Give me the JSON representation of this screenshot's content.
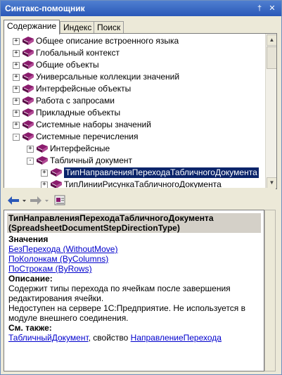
{
  "window": {
    "title": "Синтакс-помощник",
    "pin_glyph": "†",
    "close_glyph": "✕"
  },
  "tabs": [
    {
      "label": "Содержание",
      "active": true
    },
    {
      "label": "Индекс",
      "active": false
    },
    {
      "label": "Поиск",
      "active": false
    }
  ],
  "tree": [
    {
      "label": "Общее описание встроенного языка",
      "level": 0,
      "expander": "+"
    },
    {
      "label": "Глобальный контекст",
      "level": 0,
      "expander": "+"
    },
    {
      "label": "Общие объекты",
      "level": 0,
      "expander": "+"
    },
    {
      "label": "Универсальные коллекции значений",
      "level": 0,
      "expander": "+"
    },
    {
      "label": "Интерфейсные объекты",
      "level": 0,
      "expander": "+"
    },
    {
      "label": "Работа с запросами",
      "level": 0,
      "expander": "+"
    },
    {
      "label": "Прикладные объекты",
      "level": 0,
      "expander": "+"
    },
    {
      "label": "Системные наборы значений",
      "level": 0,
      "expander": "+"
    },
    {
      "label": "Системные перечисления",
      "level": 0,
      "expander": "-"
    },
    {
      "label": "Интерфейсные",
      "level": 1,
      "expander": "+"
    },
    {
      "label": "Табличный документ",
      "level": 1,
      "expander": "-"
    },
    {
      "label": "ТипНаправленияПереходаТабличногоДокумента",
      "level": 2,
      "expander": "+",
      "selected": true
    },
    {
      "label": "ТипЛинииРисункаТабличногоДокумента",
      "level": 2,
      "expander": "+"
    }
  ],
  "toolbar": {
    "back_icon": "arrow-left-icon",
    "forward_icon": "arrow-right-icon",
    "sync_icon": "sync-contents-icon"
  },
  "description": {
    "title_line1": "ТипНаправленияПереходаТабличногоДокумента",
    "title_line2": "(SpreadsheetDocumentStepDirectionType)",
    "values_heading": "Значения",
    "values": [
      "БезПерехода (WithoutMove)",
      "ПоКолонкам (ByColumns)",
      "ПоСтрокам (ByRows)"
    ],
    "description_heading": "Описание:",
    "description_text": "Содержит типы перехода по ячейкам после завершения редактирования ячейки.",
    "server_note": "Недоступен на сервере 1С:Предприятие. Не используется в модуле внешнего соединения.",
    "see_also_heading": "См. также:",
    "see_also_link1": "ТабличныйДокумент",
    "see_also_sep": ", свойство ",
    "see_also_link2": "НаправлениеПерехода"
  },
  "colors": {
    "title_bar": "#2a58b8",
    "selection": "#0a246a",
    "link": "#0000cc",
    "book": "#8b1c6e"
  }
}
